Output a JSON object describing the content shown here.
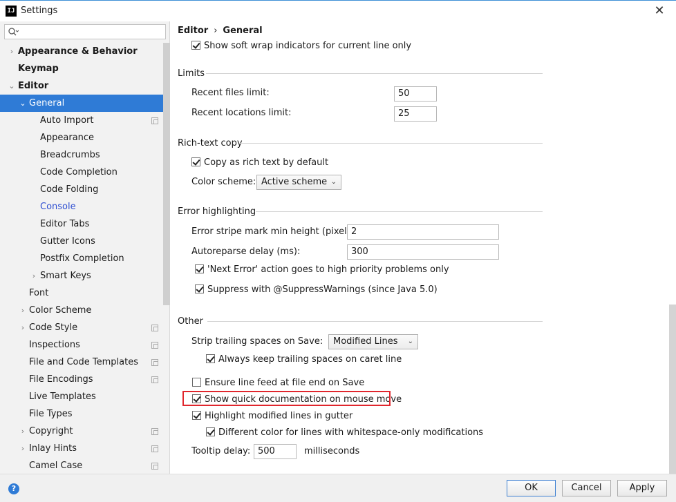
{
  "window": {
    "title": "Settings",
    "app_icon_text": "IJ",
    "close": "✕"
  },
  "sidebar": {
    "search": {
      "value": "",
      "placeholder": ""
    },
    "items": [
      {
        "label": "Appearance & Behavior",
        "level": 0,
        "arrow": "›",
        "bold": true
      },
      {
        "label": "Keymap",
        "level": 0,
        "arrow": "",
        "bold": true
      },
      {
        "label": "Editor",
        "level": 0,
        "arrow": "⌄",
        "bold": true
      },
      {
        "label": "General",
        "level": 1,
        "arrow": "⌄",
        "selected": true
      },
      {
        "label": "Auto Import",
        "level": 2,
        "icon": "copy-icon"
      },
      {
        "label": "Appearance",
        "level": 2
      },
      {
        "label": "Breadcrumbs",
        "level": 2
      },
      {
        "label": "Code Completion",
        "level": 2
      },
      {
        "label": "Code Folding",
        "level": 2
      },
      {
        "label": "Console",
        "level": 2,
        "link": true
      },
      {
        "label": "Editor Tabs",
        "level": 2
      },
      {
        "label": "Gutter Icons",
        "level": 2
      },
      {
        "label": "Postfix Completion",
        "level": 2
      },
      {
        "label": "Smart Keys",
        "level": 2,
        "arrow": "›"
      },
      {
        "label": "Font",
        "level": 1
      },
      {
        "label": "Color Scheme",
        "level": 1,
        "arrow": "›"
      },
      {
        "label": "Code Style",
        "level": 1,
        "arrow": "›",
        "icon": "copy-icon"
      },
      {
        "label": "Inspections",
        "level": 1,
        "icon": "copy-icon"
      },
      {
        "label": "File and Code Templates",
        "level": 1,
        "icon": "copy-icon"
      },
      {
        "label": "File Encodings",
        "level": 1,
        "icon": "copy-icon"
      },
      {
        "label": "Live Templates",
        "level": 1
      },
      {
        "label": "File Types",
        "level": 1
      },
      {
        "label": "Copyright",
        "level": 1,
        "arrow": "›",
        "icon": "copy-icon"
      },
      {
        "label": "Inlay Hints",
        "level": 1,
        "arrow": "›",
        "icon": "copy-icon"
      },
      {
        "label": "Camel Case",
        "level": 1,
        "icon": "copy-icon"
      }
    ]
  },
  "breadcrumb": {
    "parent": "Editor",
    "separator": "›",
    "current": "General"
  },
  "main": {
    "soft_wrap": "Show soft wrap indicators for current line only",
    "limits": {
      "header": "Limits",
      "recent_files_label": "Recent files limit:",
      "recent_files_value": "50",
      "recent_locations_label": "Recent locations limit:",
      "recent_locations_value": "25"
    },
    "rich_text": {
      "header": "Rich-text copy",
      "copy_label": "Copy as rich text by default",
      "scheme_label": "Color scheme:",
      "scheme_value": "Active scheme"
    },
    "error": {
      "header": "Error highlighting",
      "stripe_label": "Error stripe mark min height (pixels):",
      "stripe_value": "2",
      "autoreparse_label": "Autoreparse delay (ms):",
      "autoreparse_value": "300",
      "next_error_label": "'Next Error' action goes to high priority problems only",
      "suppress_label": "Suppress with @SuppressWarnings (since Java 5.0)"
    },
    "other": {
      "header": "Other",
      "strip_label": "Strip trailing spaces on Save:",
      "strip_value": "Modified Lines",
      "keep_caret_label": "Always keep trailing spaces on caret line",
      "line_feed_label": "Ensure line feed at file end on Save",
      "quick_doc_label": "Show quick documentation on mouse move",
      "highlight_modified_label": "Highlight modified lines in gutter",
      "different_color_label": "Different color for lines with whitespace-only modifications",
      "tooltip_label": "Tooltip delay:",
      "tooltip_value": "500",
      "tooltip_unit": "milliseconds"
    },
    "highlight_color": "#e0262d"
  },
  "footer": {
    "help": "?",
    "ok": "OK",
    "cancel": "Cancel",
    "apply": "Apply"
  },
  "colors": {
    "selection": "#2f7bd6",
    "link": "#2f4fd1"
  }
}
